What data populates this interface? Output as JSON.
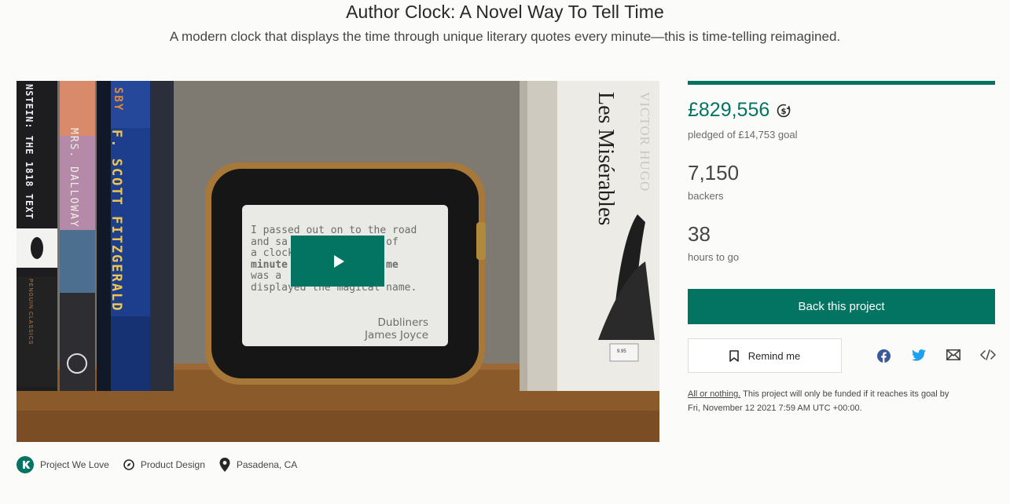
{
  "project": {
    "title": "Author Clock: A Novel Way To Tell Time",
    "subtitle": "A modern clock that displays the time through unique literary quotes every minute—this is time-telling reimagined."
  },
  "video": {
    "play_icon": "play-icon",
    "clock_quote": {
      "lines": [
        "I passed out on to the road",
        "and sa           dial of",
        "a clock           ",
        "minute             of me",
        "was a            hich",
        "displayed the magical name."
      ],
      "author_line1": "Dubliners",
      "author_line2": "James Joyce"
    },
    "book_spines": [
      "NSTEIN: THE 1818 TEXT",
      "MRS. DALLOWAY",
      "F. SCOTT FITZGERALD",
      "SBY",
      "VICTOR HUGO",
      "Les Misérables",
      "PENGUIN CLASSICS",
      "9.95"
    ]
  },
  "meta": {
    "items": [
      {
        "icon": "kickstarter-badge-icon",
        "label": "Project We Love"
      },
      {
        "icon": "compass-icon",
        "label": "Product Design"
      },
      {
        "icon": "location-pin-icon",
        "label": "Pasadena, CA"
      }
    ]
  },
  "campaign": {
    "pledged": "£829,556",
    "currency_icon": "currency-conversion-icon",
    "pledged_goal": "pledged of £14,753 goal",
    "progress_fraction": 1.0,
    "backers_count": "7,150",
    "backers_label": "backers",
    "time_count": "38",
    "time_label": "hours to go",
    "back_label": "Back this project",
    "remind_label": "Remind me",
    "share_icons": [
      "facebook-icon",
      "twitter-icon",
      "email-icon",
      "embed-icon"
    ],
    "fine_link": "All or nothing.",
    "fine_text": " This project will only be funded if it reaches its goal by",
    "fine_date": "Fri, November 12 2021 7:59 AM UTC +00:00."
  },
  "colors": {
    "brand_green": "#037362",
    "text_dark": "#282828",
    "text_muted": "#6a6a6a",
    "background": "#fbfbfa"
  }
}
